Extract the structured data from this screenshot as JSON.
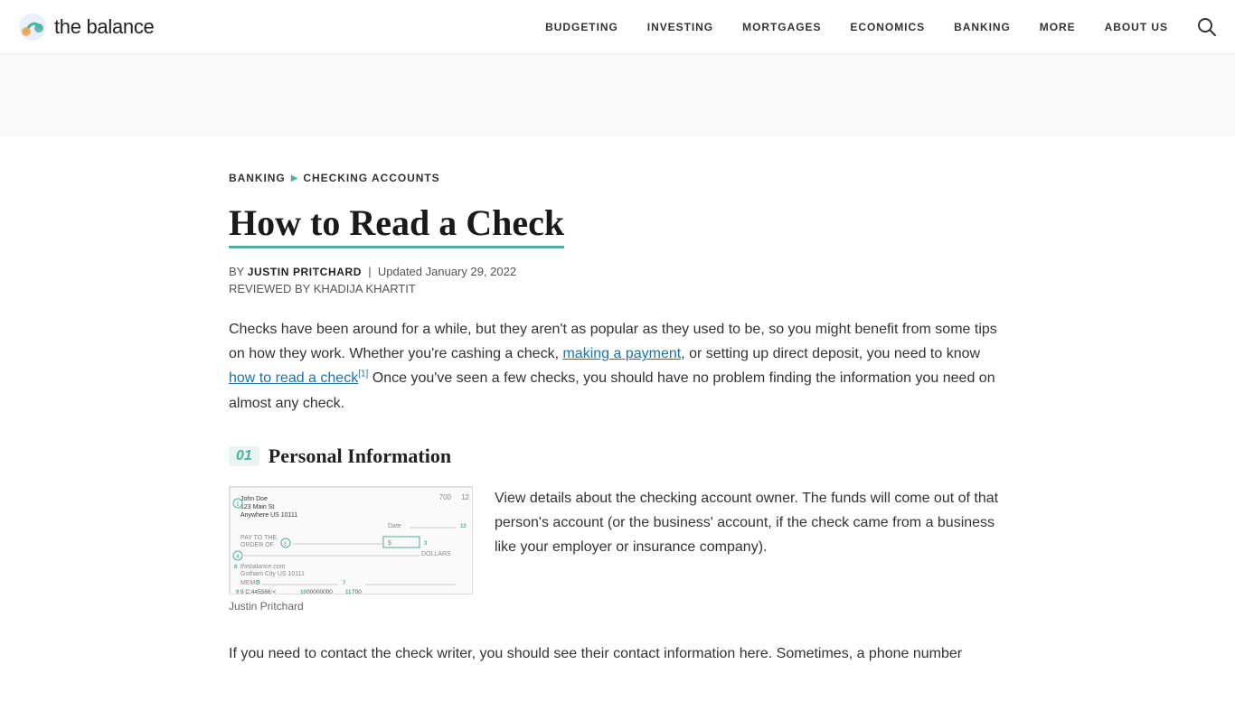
{
  "header": {
    "logo_text": "the balance",
    "nav": [
      {
        "label": "BUDGETING",
        "id": "budgeting"
      },
      {
        "label": "INVESTING",
        "id": "investing"
      },
      {
        "label": "MORTGAGES",
        "id": "mortgages"
      },
      {
        "label": "ECONOMICS",
        "id": "economics"
      },
      {
        "label": "BANKING",
        "id": "banking"
      },
      {
        "label": "MORE",
        "id": "more"
      },
      {
        "label": "ABOUT US",
        "id": "about-us"
      }
    ]
  },
  "breadcrumb": {
    "parent": "BANKING",
    "current": "CHECKING ACCOUNTS"
  },
  "article": {
    "title": "How to Read a Check",
    "byline_prefix": "BY",
    "author": "JUSTIN PRITCHARD",
    "updated_prefix": "Updated",
    "updated_date": "January 29, 2022",
    "reviewed_prefix": "REVIEWED BY",
    "reviewer": "KHADIJA KHARTIT",
    "intro": "Checks have been around for a while, but they aren't as popular as they used to be, so you might benefit from some tips on how they work. Whether you're cashing a check,",
    "intro_link1": "making a payment",
    "intro_middle": ", or setting up direct deposit, you need to know",
    "intro_link2": "how to read a check",
    "intro_footnote": "[1]",
    "intro_end": " Once you've seen a few checks, you should have no problem finding the information you need on almost any check.",
    "section1": {
      "number": "01",
      "title": "Personal Information",
      "image_caption": "Justin Pritchard",
      "text1": "View details about the checking account owner. The funds will come out of that person's account (or the business' account, if the check came from a business like your employer or insurance company).",
      "text2": "If you need to contact the check writer, you should see their contact information here. Sometimes, a phone number"
    }
  }
}
